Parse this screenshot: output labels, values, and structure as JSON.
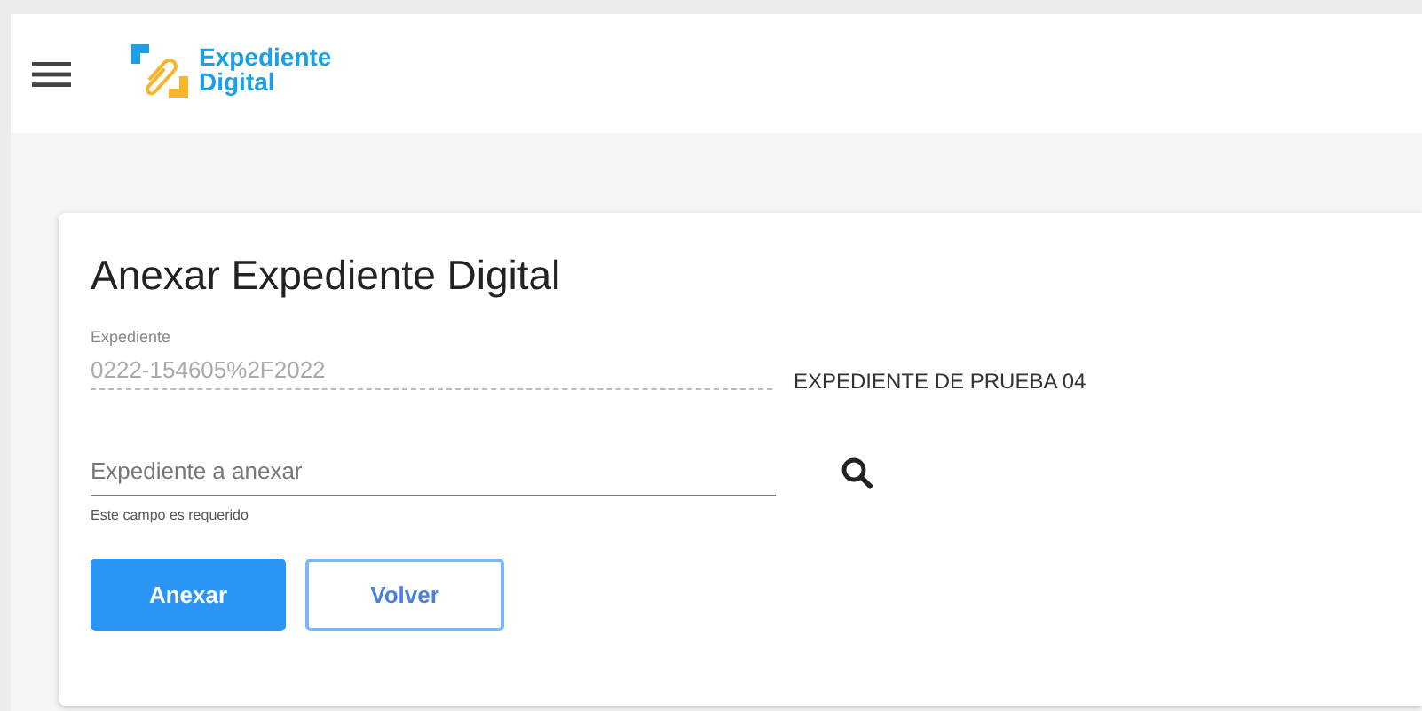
{
  "header": {
    "logo_line_1": "Expediente",
    "logo_line_2": "Digital"
  },
  "card": {
    "title": "Anexar Expediente Digital",
    "expediente": {
      "label": "Expediente",
      "value": "0222-154605%2F2022",
      "description": "EXPEDIENTE DE PRUEBA 04"
    },
    "anexar_field": {
      "placeholder": "Expediente a anexar",
      "hint": "Este campo es requerido"
    },
    "buttons": [
      {
        "label": "Anexar",
        "kind": "primary"
      },
      {
        "label": "Volver",
        "kind": "outline"
      }
    ]
  }
}
